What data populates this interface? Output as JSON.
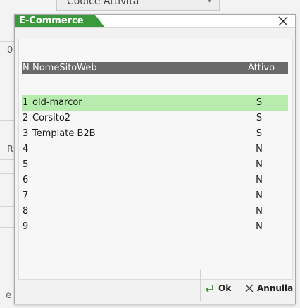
{
  "background": {
    "topbar_label": "Codice Attività",
    "side_letters": [
      "0",
      "R"
    ],
    "bottom_fragment": "e"
  },
  "dialog": {
    "title": "E-Commerce",
    "columns": {
      "n": "N",
      "name": "NomeSitoWeb",
      "active": "Attivo"
    },
    "rows": [
      {
        "n": "1",
        "name": "old-marcor",
        "active": "S"
      },
      {
        "n": "2",
        "name": "Corsito2",
        "active": "S"
      },
      {
        "n": "3",
        "name": "Template B2B",
        "active": "S"
      },
      {
        "n": "4",
        "name": "",
        "active": "N"
      },
      {
        "n": "5",
        "name": "",
        "active": "N"
      },
      {
        "n": "6",
        "name": "",
        "active": "N"
      },
      {
        "n": "7",
        "name": "",
        "active": "N"
      },
      {
        "n": "8",
        "name": "",
        "active": "N"
      },
      {
        "n": "9",
        "name": "",
        "active": "N"
      }
    ],
    "selected_row": 0,
    "buttons": {
      "ok": "Ok",
      "cancel": "Annulla"
    }
  },
  "colors": {
    "title_tab": "#3a9a3a",
    "header": "#6a6a6a",
    "selected_row": "#b8ecae"
  },
  "icons": {
    "close": "close-icon",
    "ok": "enter-arrow-icon",
    "cancel": "x-icon"
  }
}
